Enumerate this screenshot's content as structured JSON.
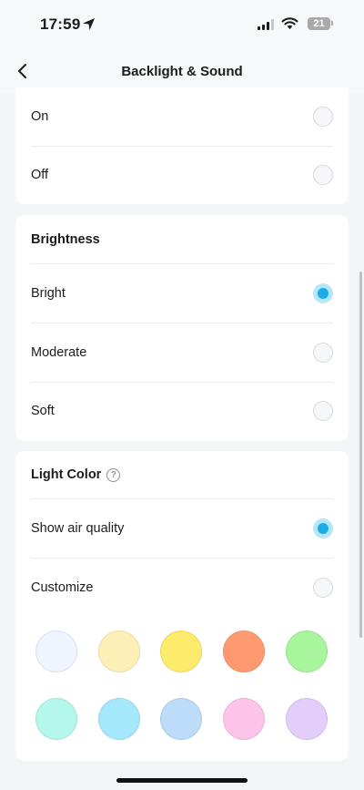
{
  "status_bar": {
    "time": "17:59",
    "battery": "21"
  },
  "nav": {
    "title": "Backlight & Sound"
  },
  "display_card": {
    "options": [
      {
        "label": "On",
        "selected": false
      },
      {
        "label": "Off",
        "selected": false
      }
    ]
  },
  "brightness": {
    "title": "Brightness",
    "options": [
      {
        "label": "Bright",
        "selected": true
      },
      {
        "label": "Moderate",
        "selected": false
      },
      {
        "label": "Soft",
        "selected": false
      }
    ]
  },
  "light_color": {
    "title": "Light Color",
    "help_icon": "?",
    "options": [
      {
        "label": "Show air quality",
        "selected": true
      },
      {
        "label": "Customize",
        "selected": false
      }
    ],
    "swatches": [
      "#eef5ff",
      "#fdefb5",
      "#fdeb6b",
      "#ff9a70",
      "#a8f59e",
      "#b5f7ea",
      "#a6e8fb",
      "#bcdcfa",
      "#fec3eb",
      "#e3cdfa"
    ]
  },
  "colors": {
    "accent": "#19aee8",
    "accent_ring": "#b6e7f8",
    "background": "#f4f5f7"
  }
}
